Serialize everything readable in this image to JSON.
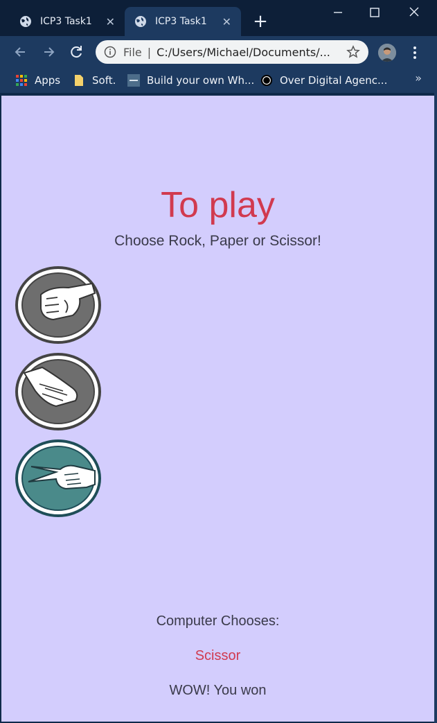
{
  "browser": {
    "tabs": [
      {
        "title": "ICP3 Task1",
        "active": false
      },
      {
        "title": "ICP3 Task1",
        "active": true
      }
    ],
    "close_glyph": "✕",
    "new_tab_glyph": "+",
    "address": {
      "scheme_label": "File",
      "url": "C:/Users/Michael/Documents/..."
    },
    "bookmarks": [
      {
        "label": "Apps",
        "icon": "apps-grid-icon"
      },
      {
        "label": "Soft.",
        "icon": "folder-icon"
      },
      {
        "label": "Build your own Wh...",
        "icon": "site-thumbnail-icon"
      },
      {
        "label": "Over Digital Agenc...",
        "icon": "ring-logo-icon"
      }
    ],
    "more_bookmarks": "»"
  },
  "page": {
    "title": "To play",
    "subtitle": "Choose Rock, Paper or Scissor!",
    "choices": [
      {
        "name": "Rock",
        "selected": false
      },
      {
        "name": "Paper",
        "selected": false
      },
      {
        "name": "Scissor",
        "selected": true
      }
    ],
    "computer_label": "Computer Chooses:",
    "computer_choice": "Scissor",
    "result": "WOW! You won"
  },
  "colors": {
    "page_bg": "#d3cdfd",
    "accent_red": "#d13a4f",
    "selected_choice": "#4a8a8a",
    "unselected_choice": "#6e6e6e"
  }
}
